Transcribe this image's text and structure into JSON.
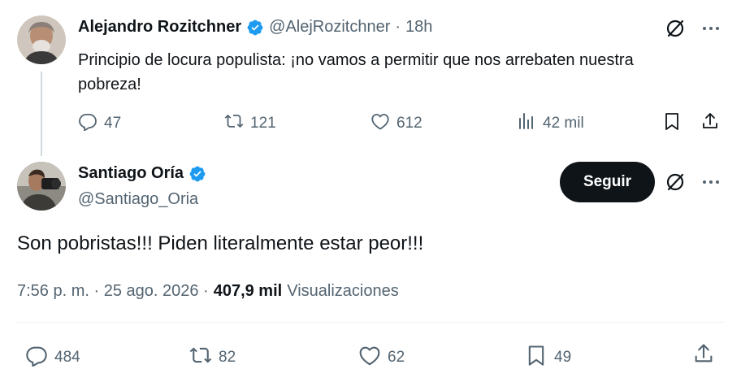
{
  "parent_tweet": {
    "author_name": "Alejandro Rozitchner",
    "author_handle": "@AlejRozitchner",
    "separator": "·",
    "time_ago": "18h",
    "text_line1": "Principio de locura populista: ¡no vamos a permitir que nos arrebaten nuestra",
    "text_line2": "pobreza!",
    "replies": "47",
    "reposts": "121",
    "likes": "612",
    "views": "42 mil"
  },
  "main_tweet": {
    "author_name": "Santiago Oría",
    "author_handle": "@Santiago_Oria",
    "follow_label": "Seguir",
    "text": "Son pobristas!!! Piden literalmente estar peor!!!",
    "timestamp": "7:56 p. m. · 25 ago. 2026 ·",
    "views_count": "407,9 mil",
    "views_label": "Visualizaciones",
    "replies": "484",
    "reposts": "82",
    "likes": "62",
    "bookmarks": "49"
  },
  "colors": {
    "text_primary": "#0f1419",
    "text_secondary": "#536471",
    "verified_blue": "#1d9bf0",
    "follow_bg": "#0f1419",
    "divider": "#eff3f4"
  },
  "icons": {
    "verified": "verified-badge-icon",
    "grok": "grok-icon",
    "more": "more-icon",
    "reply": "reply-icon",
    "repost": "repost-icon",
    "like": "like-icon",
    "views": "views-icon",
    "bookmark": "bookmark-icon",
    "share": "share-icon"
  }
}
